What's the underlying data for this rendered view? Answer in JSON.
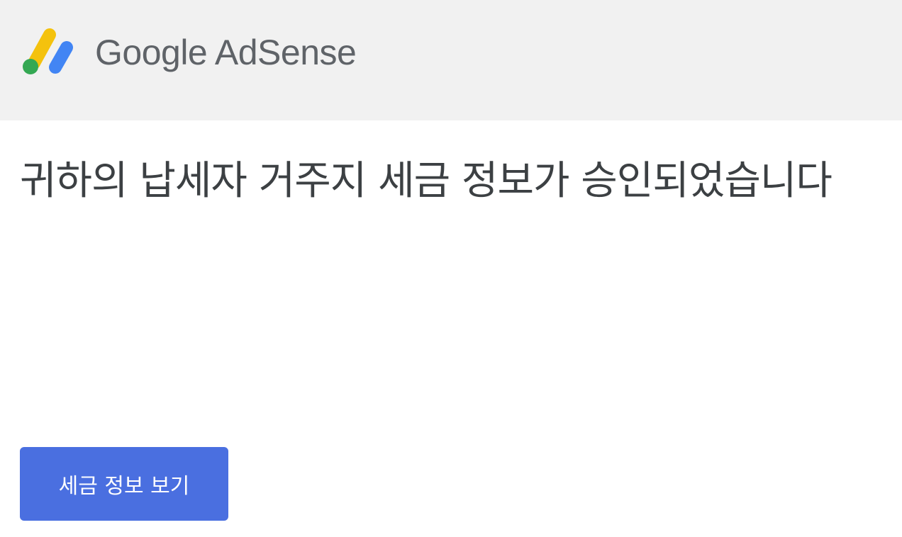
{
  "header": {
    "logo": {
      "icon": "adsense-logo-icon",
      "brand_text": "Google",
      "product_text": "AdSense",
      "colors": {
        "yellow": "#f4c20d",
        "blue": "#4285f4",
        "green": "#34a853"
      }
    }
  },
  "main": {
    "title": "귀하의 납세자 거주지 세금 정보가 승인되었습니다",
    "button": {
      "label": "세금 정보 보기",
      "color": "#4a6fe0"
    }
  }
}
